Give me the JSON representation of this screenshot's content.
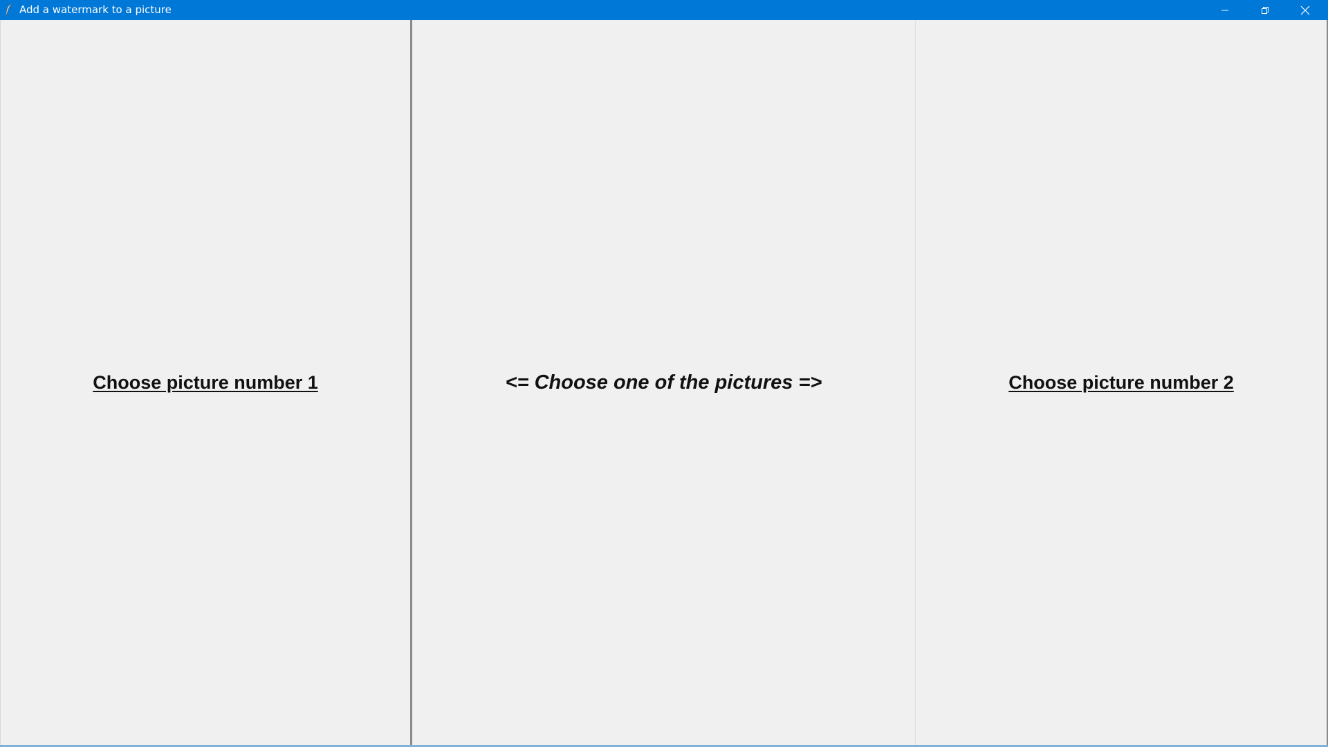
{
  "window": {
    "title": "Add a watermark to a picture",
    "app_icon": "feather-icon",
    "controls": {
      "minimize_icon": "minimize-icon",
      "maximize_icon": "restore-icon",
      "close_icon": "close-icon"
    },
    "accent_color": "#0078d7"
  },
  "left_panel": {
    "link_label": "Choose picture number 1"
  },
  "center_panel": {
    "hint": "<= Choose one of the pictures =>"
  },
  "right_panel": {
    "link_label": "Choose picture number 2"
  }
}
